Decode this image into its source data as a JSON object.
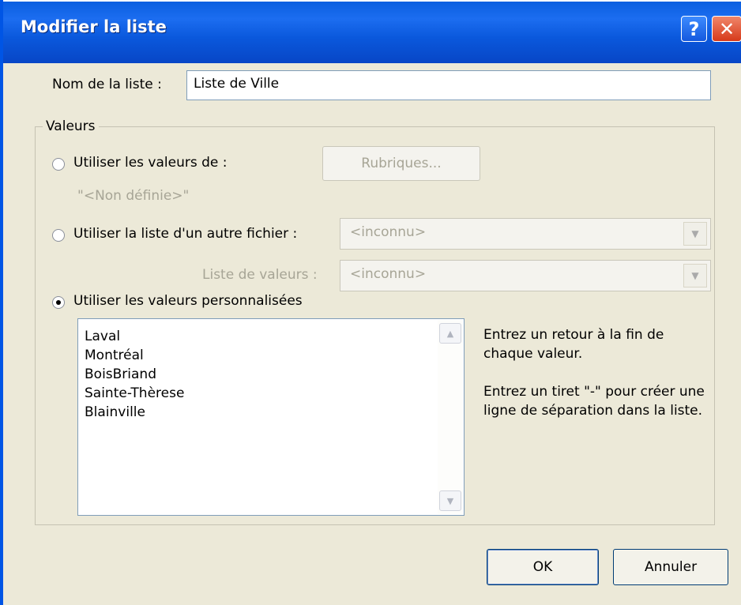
{
  "window": {
    "title": "Modifier la liste",
    "help_glyph": "?",
    "close_glyph": "✕"
  },
  "name_field": {
    "label": "Nom de la liste :",
    "value": "Liste de Ville"
  },
  "values_group": {
    "title": "Valeurs",
    "use_values_from": {
      "label": "Utiliser les valeurs de :",
      "button": "Rubriques...",
      "undefined_text": "\"<Non définie>\""
    },
    "use_other_file": {
      "label": "Utiliser la liste d'un autre fichier :",
      "select_value": "<inconnu>"
    },
    "value_list": {
      "label": "Liste de valeurs :",
      "select_value": "<inconnu>"
    },
    "custom_values": {
      "label": "Utiliser les valeurs personnalisées",
      "selected": true,
      "items": [
        "Laval",
        "Montréal",
        "BoisBriand",
        "Sainte-Thèrese",
        "Blainville"
      ]
    },
    "hint_1": "Entrez un retour à la fin de chaque valeur.",
    "hint_2": "Entrez un tiret \"-\" pour créer une ligne de séparation dans la liste."
  },
  "buttons": {
    "ok": "OK",
    "cancel": "Annuler"
  },
  "colors": {
    "titlebar": "#0a5fe0",
    "dialog_bg": "#ece9d8"
  }
}
